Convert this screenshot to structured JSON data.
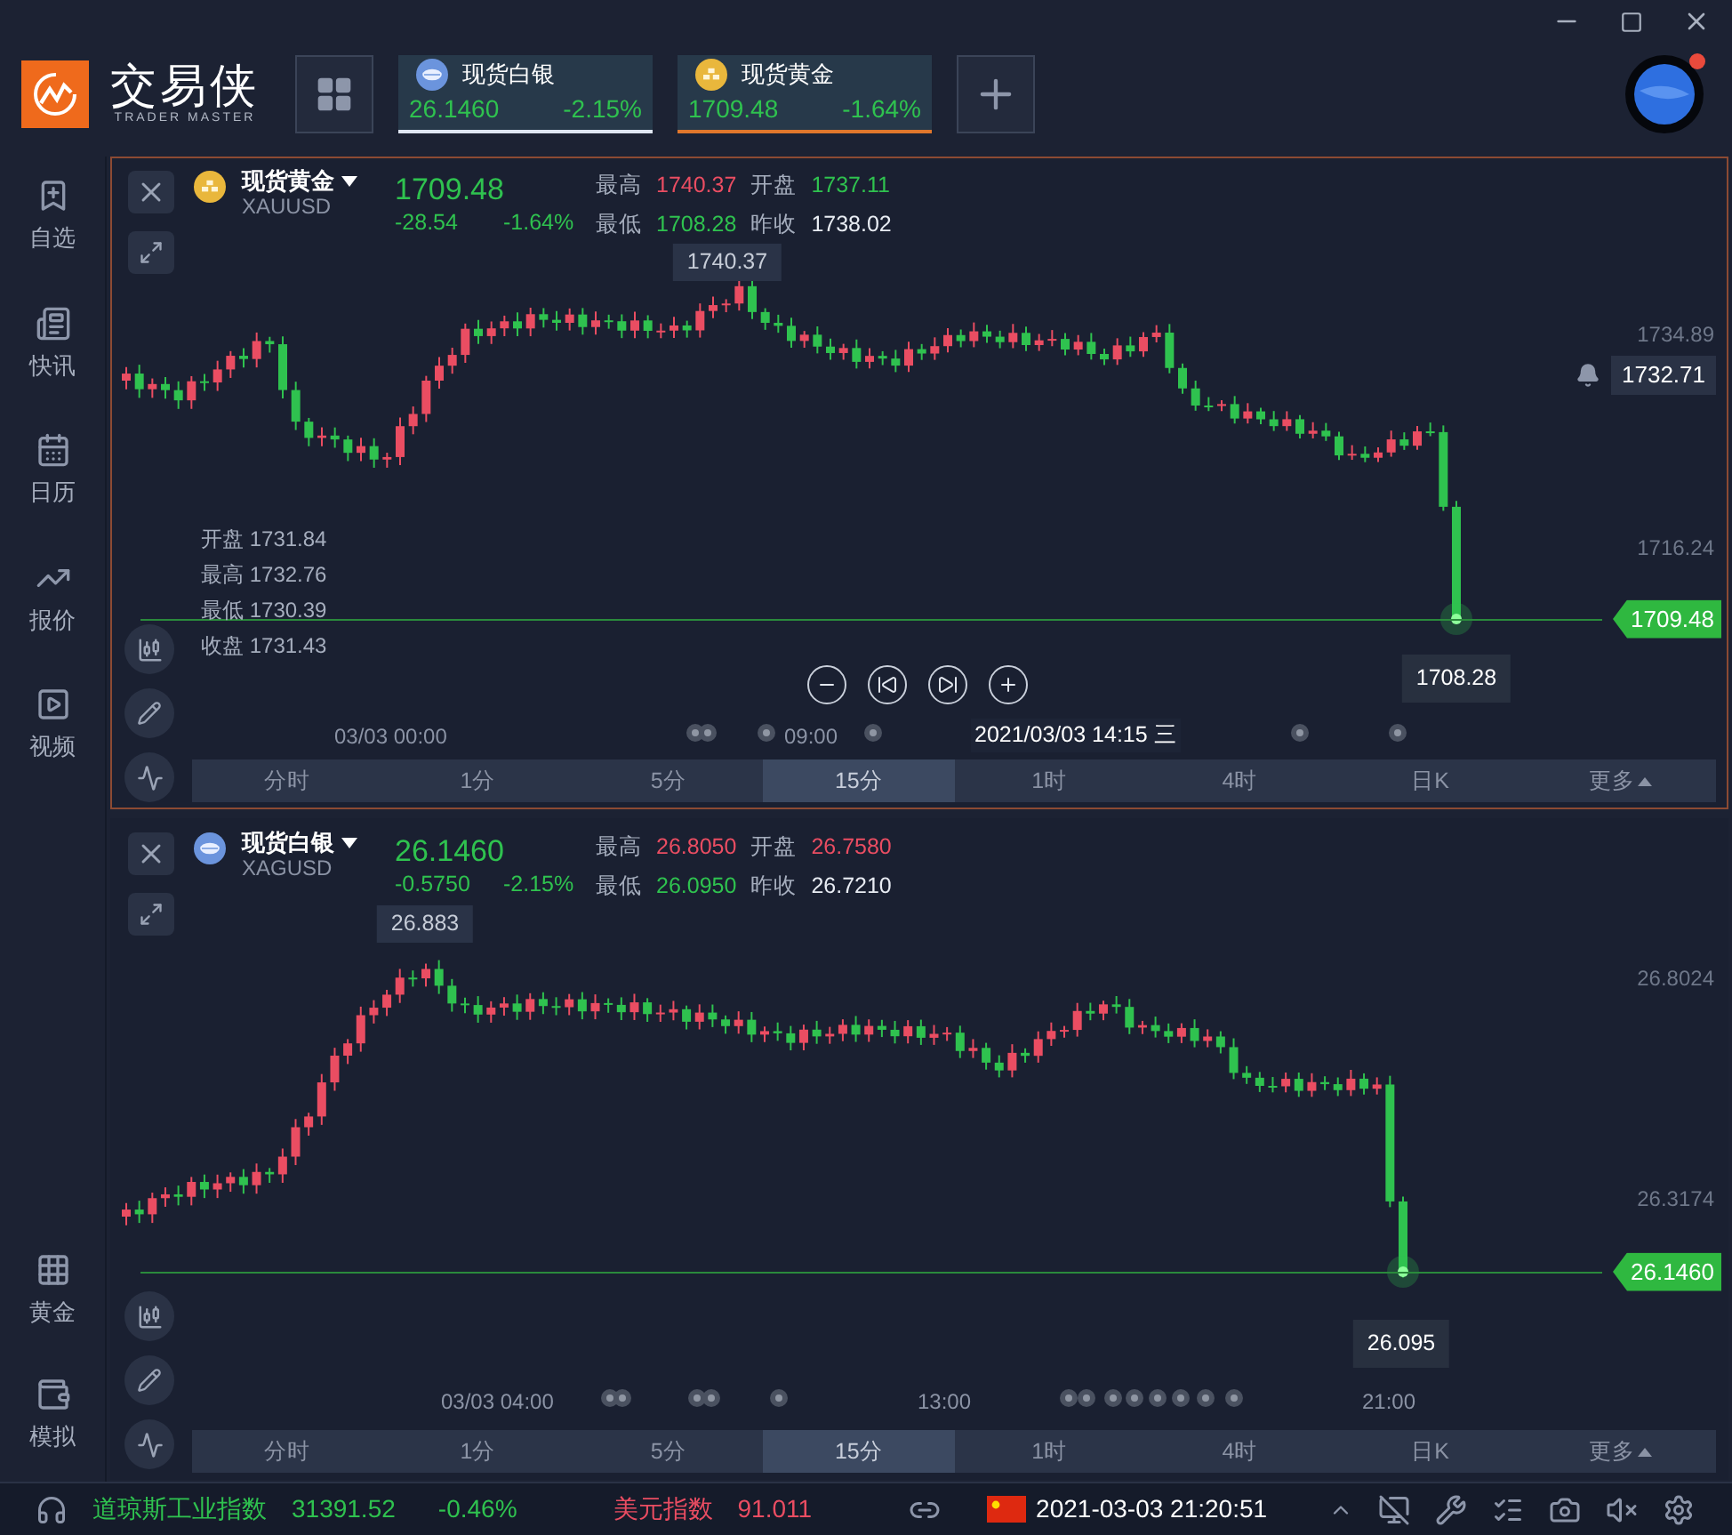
{
  "brand": {
    "name": "交易侠",
    "tagline": "TRADER MASTER"
  },
  "quote_tabs": [
    {
      "name": "现货白银",
      "kind": "silver",
      "price": "26.1460",
      "change": "-2.15%",
      "color": "#dfe6f2"
    },
    {
      "name": "现货黄金",
      "kind": "gold",
      "price": "1709.48",
      "change": "-1.64%",
      "color": "#e0772c"
    }
  ],
  "notification": true,
  "sidebar": {
    "top": [
      {
        "label": "自选",
        "kind": "bookmark"
      },
      {
        "label": "快讯",
        "kind": "news"
      },
      {
        "label": "日历",
        "kind": "calendar"
      },
      {
        "label": "报价",
        "kind": "quote"
      },
      {
        "label": "视频",
        "kind": "video"
      }
    ],
    "bottom": [
      {
        "label": "黄金",
        "kind": "gold"
      },
      {
        "label": "模拟",
        "kind": "wallet"
      }
    ]
  },
  "charts": [
    {
      "selected": true,
      "kind": "gold",
      "name": "现货黄金",
      "symbol": "XAUUSD",
      "price": "1709.48",
      "change": "-28.54",
      "change_pct": "-1.64%",
      "stats": [
        {
          "label": "最高",
          "value": "1740.37",
          "color": "#ea4d62"
        },
        {
          "label": "开盘",
          "value": "1737.11",
          "color": "#2fc24f"
        },
        {
          "label": "最低",
          "value": "1708.28",
          "color": "#2fc24f"
        },
        {
          "label": "昨收",
          "value": "1738.02",
          "color": "#e8ecf3"
        }
      ],
      "high_tooltip": "1740.37",
      "low_tooltip": "1708.28",
      "axis_labels": [
        "1734.89",
        "1716.24"
      ],
      "alert_price": "1732.71",
      "last_price": "1709.48",
      "ohlc": [
        {
          "label": "开盘",
          "value": "1731.84"
        },
        {
          "label": "最高",
          "value": "1732.76"
        },
        {
          "label": "最低",
          "value": "1730.39"
        },
        {
          "label": "收盘",
          "value": "1731.43"
        }
      ],
      "hover_controls": true,
      "time_labels": [
        "03/03 00:00",
        "09:00"
      ],
      "crosshair_time": "2021/03/03 14:15 三",
      "periods": [
        {
          "label": "分时",
          "selected": false
        },
        {
          "label": "1分",
          "selected": false
        },
        {
          "label": "5分",
          "selected": false
        },
        {
          "label": "15分",
          "selected": true
        },
        {
          "label": "1时",
          "selected": false
        },
        {
          "label": "4时",
          "selected": false
        },
        {
          "label": "日K",
          "selected": false
        },
        {
          "label": "更多",
          "selected": false
        }
      ]
    },
    {
      "selected": false,
      "kind": "silver",
      "name": "现货白银",
      "symbol": "XAGUSD",
      "price": "26.1460",
      "change": "-0.5750",
      "change_pct": "-2.15%",
      "stats": [
        {
          "label": "最高",
          "value": "26.8050",
          "color": "#ea4d62"
        },
        {
          "label": "开盘",
          "value": "26.7580",
          "color": "#ea4d62"
        },
        {
          "label": "最低",
          "value": "26.0950",
          "color": "#2fc24f"
        },
        {
          "label": "昨收",
          "value": "26.7210",
          "color": "#e8ecf3"
        }
      ],
      "high_tooltip": "26.883",
      "low_tooltip": "26.095",
      "axis_labels": [
        "26.8024",
        "26.3174"
      ],
      "last_price": "26.1460",
      "hover_controls": false,
      "time_labels": [
        "03/03 04:00",
        "13:00",
        "21:00"
      ],
      "periods": [
        {
          "label": "分时",
          "selected": false
        },
        {
          "label": "1分",
          "selected": false
        },
        {
          "label": "5分",
          "selected": false
        },
        {
          "label": "15分",
          "selected": true
        },
        {
          "label": "1时",
          "selected": false
        },
        {
          "label": "4时",
          "selected": false
        },
        {
          "label": "日K",
          "selected": false
        },
        {
          "label": "更多",
          "selected": false
        }
      ]
    }
  ],
  "status_bar": {
    "index_name": "道琼斯工业指数",
    "index_value": "31391.52",
    "index_change": "-0.46%",
    "dollar_name": "美元指数",
    "dollar_value": "91.011",
    "datetime": "2021-03-03 21:20:51"
  }
}
